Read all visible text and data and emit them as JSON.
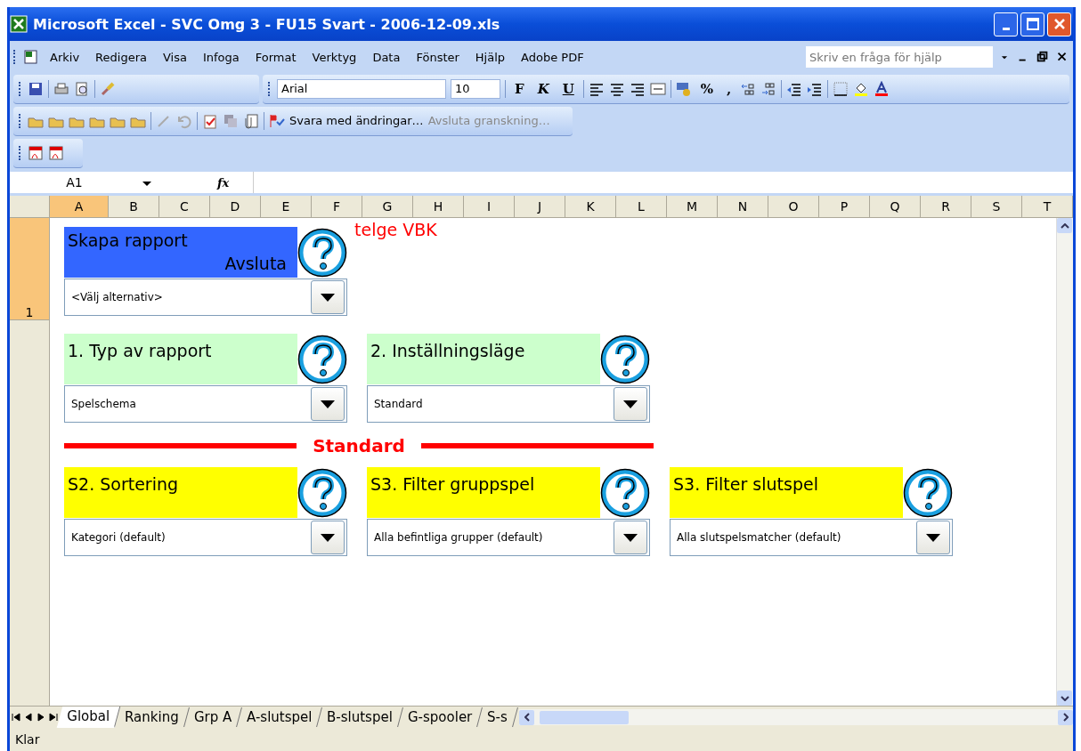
{
  "window": {
    "title": "Microsoft Excel - SVC Omg 3 - FU15 Svart - 2006-12-09.xls"
  },
  "menu": [
    "Arkiv",
    "Redigera",
    "Visa",
    "Infoga",
    "Format",
    "Verktyg",
    "Data",
    "Fönster",
    "Hjälp",
    "Adobe PDF"
  ],
  "help_box": {
    "placeholder": "Skriv en fråga för hjälp"
  },
  "formatting_toolbar": {
    "font": "Arial",
    "size": "10",
    "bold": "F",
    "italic": "K",
    "underline": "U",
    "percent": "%",
    "comma": ","
  },
  "review_toolbar": {
    "reply": "Svara med ändringar…",
    "end_review": "Avsluta granskning…"
  },
  "formula_bar": {
    "name_box": "A1",
    "fx": "fx"
  },
  "columns": [
    {
      "label": "A",
      "selected": true
    },
    {
      "label": "B",
      "selected": false
    },
    {
      "label": "C",
      "selected": false
    },
    {
      "label": "D",
      "selected": false
    },
    {
      "label": "E",
      "selected": false
    },
    {
      "label": "F",
      "selected": false
    },
    {
      "label": "G",
      "selected": false
    },
    {
      "label": "H",
      "selected": false
    },
    {
      "label": "I",
      "selected": false
    },
    {
      "label": "J",
      "selected": false
    },
    {
      "label": "K",
      "selected": false
    },
    {
      "label": "L",
      "selected": false
    },
    {
      "label": "M",
      "selected": false
    },
    {
      "label": "N",
      "selected": false
    },
    {
      "label": "O",
      "selected": false
    },
    {
      "label": "P",
      "selected": false
    },
    {
      "label": "Q",
      "selected": false
    },
    {
      "label": "R",
      "selected": false
    },
    {
      "label": "S",
      "selected": false
    },
    {
      "label": "T",
      "selected": false
    }
  ],
  "rows": [
    {
      "label": "1",
      "selected": true
    }
  ],
  "sheet": {
    "main_panel": {
      "title": "Skapa rapport",
      "action": "Avsluta",
      "value": "<Välj alternativ>",
      "color": "#3366ff"
    },
    "note": "telge VBK",
    "settings_panels": [
      {
        "title": "1. Typ av rapport",
        "value": "Spelschema",
        "color": "#ccffcc"
      },
      {
        "title": "2. Inställningsläge",
        "value": "Standard",
        "color": "#ccffcc"
      }
    ],
    "section_title": "Standard",
    "filter_panels": [
      {
        "title": "S2. Sortering",
        "value": "Kategori (default)",
        "color": "#ffff00"
      },
      {
        "title": "S3. Filter gruppspel",
        "value": "Alla befintliga grupper (default)",
        "color": "#ffff00"
      },
      {
        "title": "S3. Filter slutspel",
        "value": "Alla slutspelsmatcher (default)",
        "color": "#ffff00"
      }
    ]
  },
  "sheet_tabs": [
    {
      "label": "Global",
      "selected": true
    },
    {
      "label": "Ranking",
      "selected": false
    },
    {
      "label": "Grp A",
      "selected": false
    },
    {
      "label": "A-slutspel",
      "selected": false
    },
    {
      "label": "B-slutspel",
      "selected": false
    },
    {
      "label": "G-spooler",
      "selected": false
    },
    {
      "label": "S-s",
      "selected": false
    }
  ],
  "status_bar": {
    "text": "Klar"
  }
}
